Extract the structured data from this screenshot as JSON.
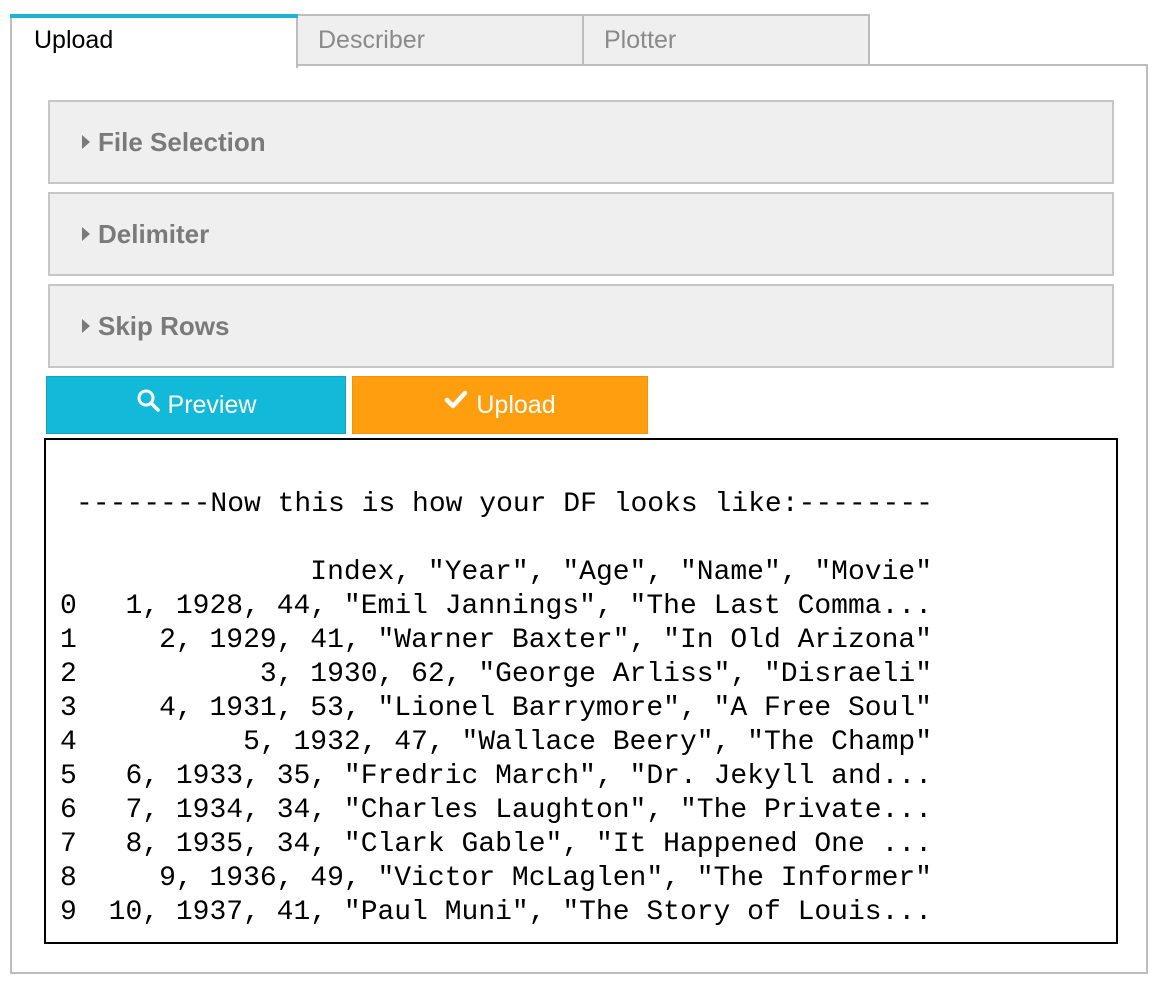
{
  "tabs": [
    {
      "label": "Upload",
      "active": true
    },
    {
      "label": "Describer",
      "active": false
    },
    {
      "label": "Plotter",
      "active": false
    }
  ],
  "accordion": [
    {
      "label": "File Selection",
      "icon": "caret-right-icon"
    },
    {
      "label": "Delimiter",
      "icon": "caret-right-icon"
    },
    {
      "label": "Skip Rows",
      "icon": "caret-right-icon"
    }
  ],
  "buttons": {
    "preview": {
      "label": "Preview",
      "icon": "search-icon",
      "color": "#12b9d8"
    },
    "upload": {
      "label": "Upload",
      "icon": "check-icon",
      "color": "#ff9e0f"
    }
  },
  "colors": {
    "active_tab_accent": "#1cb3d6"
  },
  "output": {
    "heading": "--------Now this is how your DF looks like:--------",
    "header": "Index, \"Year\", \"Age\", \"Name\", \"Movie\"",
    "rows": [
      {
        "index": "0",
        "value": "1, 1928, 44, \"Emil Jannings\", \"The Last Comma..."
      },
      {
        "index": "1",
        "value": "2, 1929, 41, \"Warner Baxter\", \"In Old Arizona\""
      },
      {
        "index": "2",
        "value": "3, 1930, 62, \"George Arliss\", \"Disraeli\""
      },
      {
        "index": "3",
        "value": "4, 1931, 53, \"Lionel Barrymore\", \"A Free Soul\""
      },
      {
        "index": "4",
        "value": "5, 1932, 47, \"Wallace Beery\", \"The Champ\""
      },
      {
        "index": "5",
        "value": "6, 1933, 35, \"Fredric March\", \"Dr. Jekyll and..."
      },
      {
        "index": "6",
        "value": "7, 1934, 34, \"Charles Laughton\", \"The Private..."
      },
      {
        "index": "7",
        "value": "8, 1935, 34, \"Clark Gable\", \"It Happened One ..."
      },
      {
        "index": "8",
        "value": "9, 1936, 49, \"Victor McLaglen\", \"The Informer\""
      },
      {
        "index": "9",
        "value": "10, 1937, 41, \"Paul Muni\", \"The Story of Louis..."
      }
    ]
  }
}
